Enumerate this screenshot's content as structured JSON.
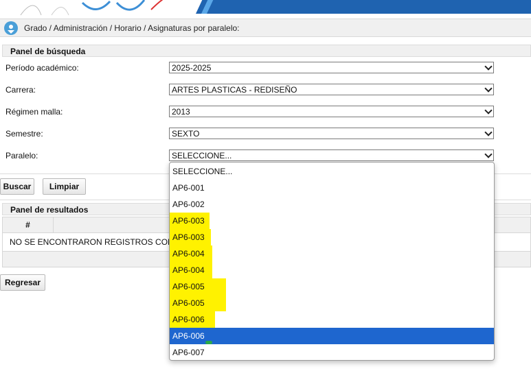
{
  "breadcrumb": "Grado / Administración / Horario / Asignaturas por paralelo:",
  "search_panel": {
    "title": "Panel de búsqueda",
    "fields": [
      {
        "label": "Período académico:",
        "value": "2025-2025"
      },
      {
        "label": "Carrera:",
        "value": "ARTES PLASTICAS - REDISEÑO"
      },
      {
        "label": "Régimen malla:",
        "value": "2013"
      },
      {
        "label": "Semestre:",
        "value": "SEXTO"
      },
      {
        "label": "Paralelo:",
        "value": "SELECCIONE..."
      }
    ]
  },
  "buttons": {
    "search": "Buscar",
    "clear": "Limpiar",
    "back": "Regresar"
  },
  "results_panel": {
    "title": "Panel de resultados",
    "column_index": "#",
    "empty_message": "NO SE ENCONTRARON REGISTROS CON LOS"
  },
  "paralelo_dropdown": {
    "options": [
      "SELECCIONE...",
      "AP6-001",
      "AP6-002",
      "AP6-003",
      "AP6-003",
      "AP6-004",
      "AP6-004",
      "AP6-005",
      "AP6-005",
      "AP6-006",
      "AP6-006",
      "AP6-007"
    ],
    "selected_index": 10,
    "highlighted_indices": [
      3,
      4,
      5,
      6,
      7,
      8,
      9
    ]
  },
  "colors": {
    "selection": "#1e66cf",
    "highlighter": "#fff200",
    "banner": "#1f63b0"
  }
}
